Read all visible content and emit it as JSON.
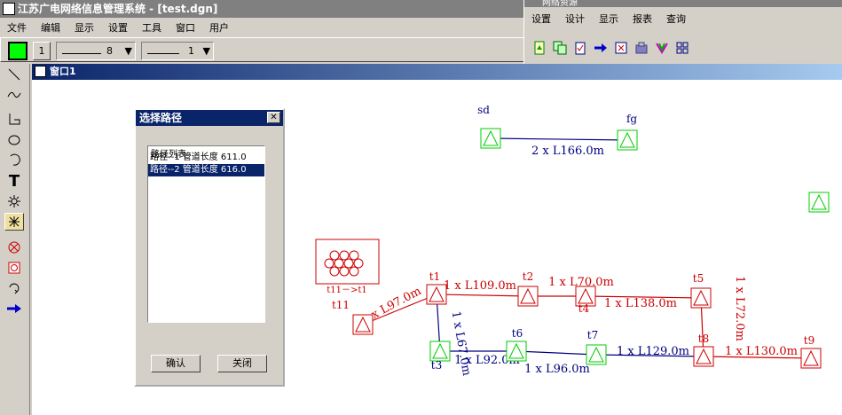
{
  "app": {
    "title": "江苏广电网络信息管理系统 - [test.dgn]"
  },
  "menu": [
    "文件",
    "编辑",
    "显示",
    "设置",
    "工具",
    "窗口",
    "用户"
  ],
  "toolbar": {
    "weight_value": "1",
    "line_style_value": "8",
    "line_weight_value": "1"
  },
  "res_window": {
    "title": "网络资源",
    "menu": [
      "设置",
      "设计",
      "显示",
      "报表",
      "查询"
    ]
  },
  "doc": {
    "title": "窗口1"
  },
  "dialog": {
    "title": "选择路径",
    "list_header": "路径列表",
    "items": [
      "路径--1 管道长度 611.0",
      "路径--2 管道长度 616.0"
    ],
    "selected_index": 1,
    "ok_label": "确认",
    "close_label": "关闭"
  },
  "diagram": {
    "nodes": [
      {
        "label": "sd",
        "color": "#00cc00"
      },
      {
        "label": "fg",
        "color": "#00cc00"
      },
      {
        "label": "",
        "color": "#00cc00"
      },
      {
        "label": "t1",
        "color": "#cc0000"
      },
      {
        "label": "t2",
        "color": "#cc0000"
      },
      {
        "label": "t4",
        "color": "#cc0000"
      },
      {
        "label": "t5",
        "color": "#cc0000"
      },
      {
        "label": "t11",
        "color": "#cc0000"
      },
      {
        "label": "t3",
        "color": "#00cc00"
      },
      {
        "label": "t6",
        "color": "#00cc00"
      },
      {
        "label": "t7",
        "color": "#00cc00"
      },
      {
        "label": "t8",
        "color": "#cc0000"
      },
      {
        "label": "t9",
        "color": "#cc0000"
      }
    ],
    "edges": [
      {
        "label": "2 x L166.0m",
        "color": "#000080"
      },
      {
        "label": "1 x L97.0m",
        "color": "#cc0000"
      },
      {
        "label": "1 x L109.0m",
        "color": "#cc0000"
      },
      {
        "label": "1 x L70.0m",
        "color": "#cc0000"
      },
      {
        "label": "1 x L138.0m",
        "color": "#cc0000"
      },
      {
        "label": "1 x L72.0m",
        "color": "#cc0000"
      },
      {
        "label": "1 x L67.0m",
        "color": "#000080"
      },
      {
        "label": "1 x L92.0m",
        "color": "#000080"
      },
      {
        "label": "1 x L96.0m",
        "color": "#000080"
      },
      {
        "label": "1 x L129.0m",
        "color": "#000080"
      },
      {
        "label": "1 x L130.0m",
        "color": "#cc0000"
      }
    ],
    "annotation": "t11－>t1"
  }
}
